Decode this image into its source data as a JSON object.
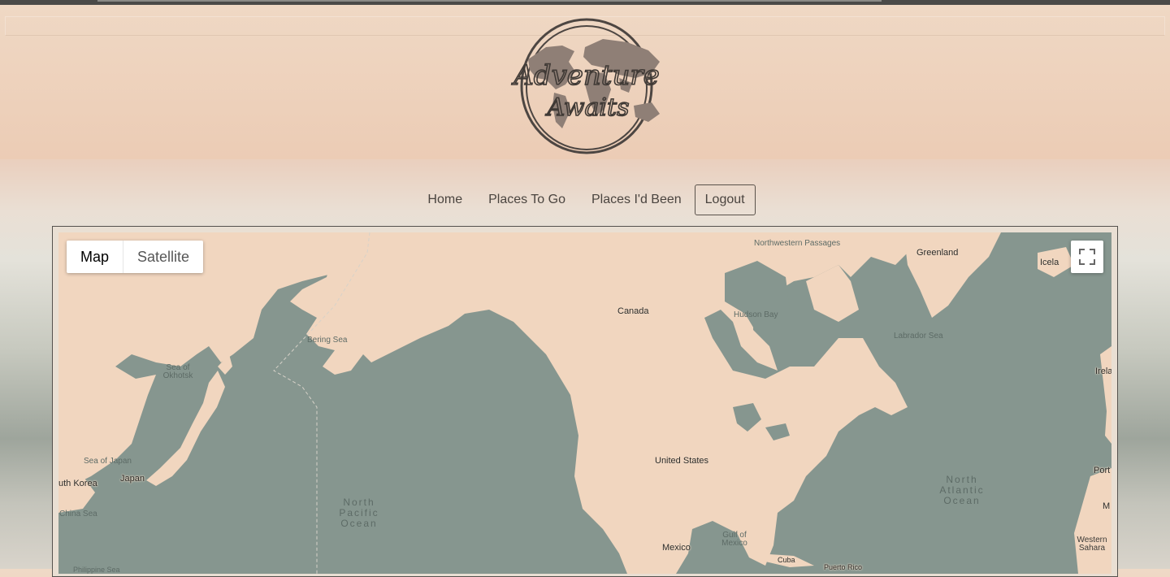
{
  "logo": {
    "text_line1": "Adventure",
    "text_line2": "Awaits"
  },
  "nav": {
    "items": [
      {
        "label": "Home"
      },
      {
        "label": "Places To Go"
      },
      {
        "label": "Places I'd Been"
      },
      {
        "label": "Logout"
      }
    ]
  },
  "map": {
    "type_controls": {
      "map_label": "Map",
      "satellite_label": "Satellite",
      "selected": "Map"
    },
    "fullscreen_icon": "fullscreen-icon",
    "labels": {
      "northwestern_passages": "Northwestern Passages",
      "greenland": "Greenland",
      "iceland": "Icela",
      "canada": "Canada",
      "hudson_bay": "Hudson Bay",
      "bering_sea": "Bering Sea",
      "labrador_sea": "Labrador Sea",
      "sea_of_okhotsk": "Sea of Okhotsk",
      "ireland": "Irela",
      "united_states": "United States",
      "sea_of_japan": "Sea of Japan",
      "japan": "Japan",
      "south_korea": "uth Korea",
      "north_pacific": "North Pacific Ocean",
      "north_atlantic": "North Atlantic Ocean",
      "east_china_sea": "China Sea",
      "portugal": "Port",
      "morocco": "M",
      "mexico": "Mexico",
      "gulf_of_mexico": "Gulf of Mexico",
      "western_sahara": "Western Sahara",
      "cuba": "Cuba",
      "puerto_rico": "Puerto Rico",
      "philippine_sea": "Philippine Sea"
    }
  },
  "colors": {
    "land": "#f1d6bf",
    "water": "#86968f",
    "header": "#ecccb5"
  }
}
